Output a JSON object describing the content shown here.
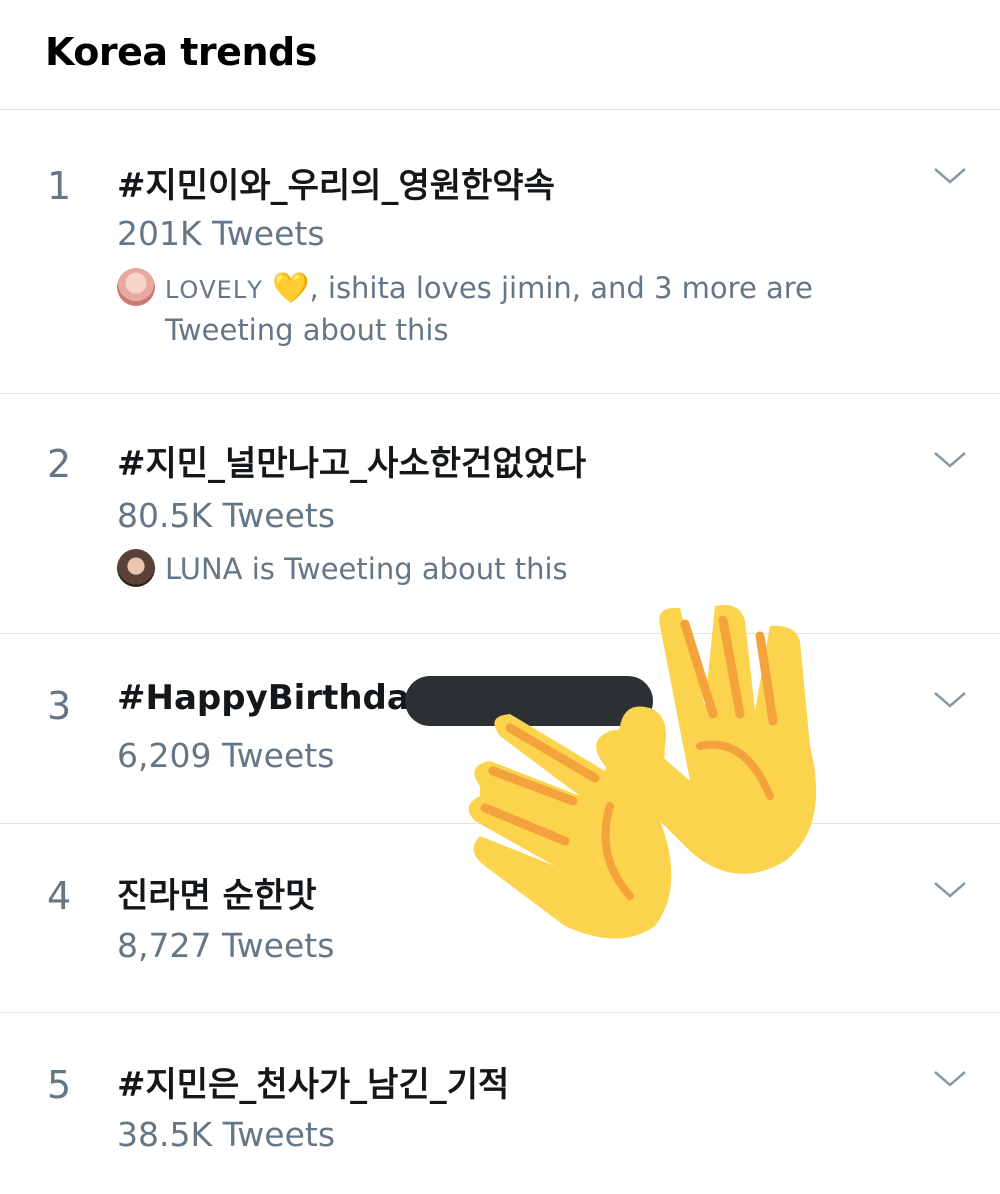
{
  "header": {
    "title": "Korea trends"
  },
  "trends": [
    {
      "rank": "1",
      "name": "#지민이와_우리의_영원한약속",
      "count": "201K Tweets",
      "social_first": "ᒪOᐯEᒪY",
      "social_heart": "💛",
      "social_text": ", ishita loves jimin, and 3 more are",
      "social_rest": "Tweeting about this"
    },
    {
      "rank": "2",
      "name": "#지민_널만나고_사소한건없었다",
      "count": "80.5K Tweets",
      "social_first": "LUNA is Tweeting about this"
    },
    {
      "rank": "3",
      "name": "#HappyBirthday",
      "count": "6,209 Tweets"
    },
    {
      "rank": "4",
      "name": "진라면 순한맛",
      "count": "8,727 Tweets"
    },
    {
      "rank": "5",
      "name": "#지민은_천사가_남긴_기적",
      "count": "38.5K Tweets"
    }
  ],
  "colors": {
    "accent": "#657786",
    "redaction": "#2c3033",
    "hands": "#fcd34d"
  },
  "overlay": {
    "icon": "raising-hands-emoji"
  }
}
